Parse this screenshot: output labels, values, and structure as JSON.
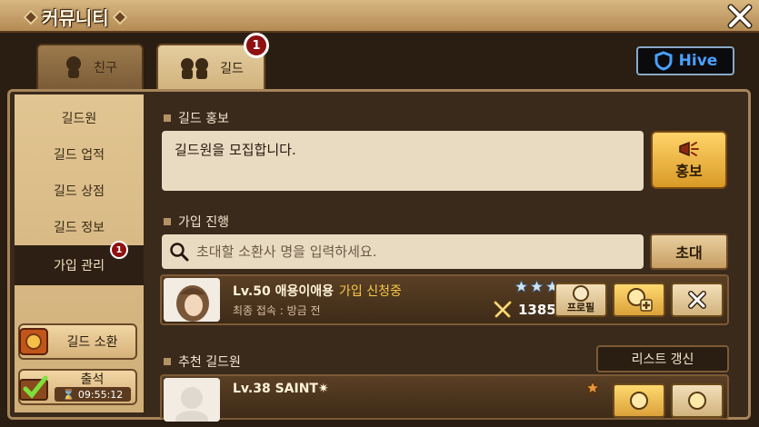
{
  "window": {
    "title": "커뮤니티"
  },
  "tabs": [
    {
      "label": "친구"
    },
    {
      "label": "길드",
      "badge": "1"
    }
  ],
  "hive": {
    "label": "Hive"
  },
  "sidebar": {
    "items": [
      {
        "label": "길드원"
      },
      {
        "label": "길드 업적"
      },
      {
        "label": "길드 상점"
      },
      {
        "label": "길드 정보"
      },
      {
        "label": "가입 관리",
        "badge": "1",
        "active": true
      }
    ],
    "summon_label": "길드 소환",
    "attend_label": "출석",
    "attend_time": "09:55:12"
  },
  "promo": {
    "section_title": "길드 홍보",
    "message": "길드원을 모집합니다.",
    "button_label": "홍보"
  },
  "join": {
    "section_title": "가입 진행",
    "search_placeholder": "초대할 소환사 명을 입력하세요.",
    "invite_label": "초대",
    "applicant": {
      "name": "Lv.50 애용이애용",
      "status": "가입 신청중",
      "last_login": "최종 접속 : 방금 전",
      "power": "1385",
      "stars": 3,
      "profile_label": "프로필"
    }
  },
  "recommend": {
    "section_title": "추천 길드원",
    "refresh_label": "리스트 갱신",
    "member": {
      "name": "Lv.38 SAINT✷",
      "stars": 1
    }
  },
  "colors": {
    "accent_gold": "#f8c84a",
    "badge_red": "#8e1010",
    "hive_blue": "#49a0ff"
  }
}
